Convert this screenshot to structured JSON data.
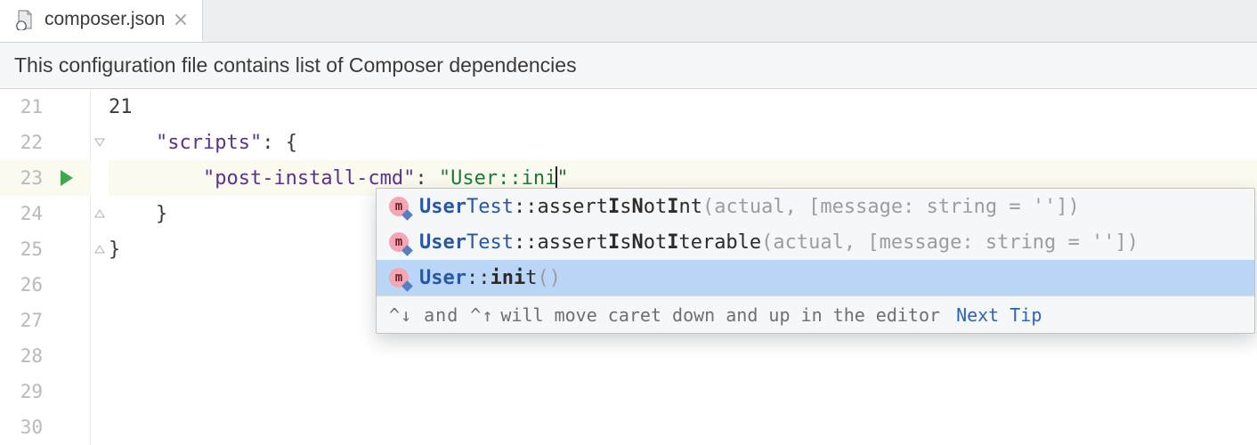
{
  "tab": {
    "filename": "composer.json"
  },
  "banner": {
    "text": "This configuration file contains list of Composer dependencies"
  },
  "icons": {
    "method_badge": "m"
  },
  "gutter": {
    "lines": [
      "21",
      "22",
      "23",
      "24",
      "25",
      "26",
      "27",
      "28",
      "29",
      "30"
    ],
    "run_marker_line": "23"
  },
  "code": {
    "l21": "21",
    "l22_key": "\"scripts\"",
    "l22_after": ": {",
    "l23_key": "\"post-install-cmd\"",
    "l23_colon": ": ",
    "l23_val_open": "\"",
    "l23_val_text": "User::ini",
    "l23_val_close": "\"",
    "l24_close": "}",
    "l25_close": "}"
  },
  "completion": {
    "items": [
      {
        "cls_pre": "User",
        "cls_hl": "",
        "cls_post": "Test",
        "sep": "::",
        "m_pre": "assert",
        "m_hl": "I",
        "m_mid": "s",
        "m_hl2": "N",
        "m_mid2": "ot",
        "m_hl3": "I",
        "m_post": "nt",
        "params": "(actual, [message: string = ''])",
        "selected": false
      },
      {
        "cls_pre": "User",
        "cls_hl": "",
        "cls_post": "Test",
        "sep": "::",
        "m_pre": "assert",
        "m_hl": "I",
        "m_mid": "s",
        "m_hl2": "N",
        "m_mid2": "ot",
        "m_hl3": "I",
        "m_post": "terable",
        "params": "(actual, [message: string = ''])",
        "selected": false
      },
      {
        "cls_pre": "User",
        "cls_hl": "",
        "cls_post": "",
        "sep": "::",
        "m_pre": "",
        "m_hl": "ini",
        "m_mid": "t",
        "m_hl2": "",
        "m_mid2": "",
        "m_hl3": "",
        "m_post": "",
        "params": "()",
        "selected": true
      }
    ],
    "tip_keys": "^↓ and ^↑",
    "tip_text": " will move caret down and up in the editor",
    "tip_link": "Next Tip"
  }
}
